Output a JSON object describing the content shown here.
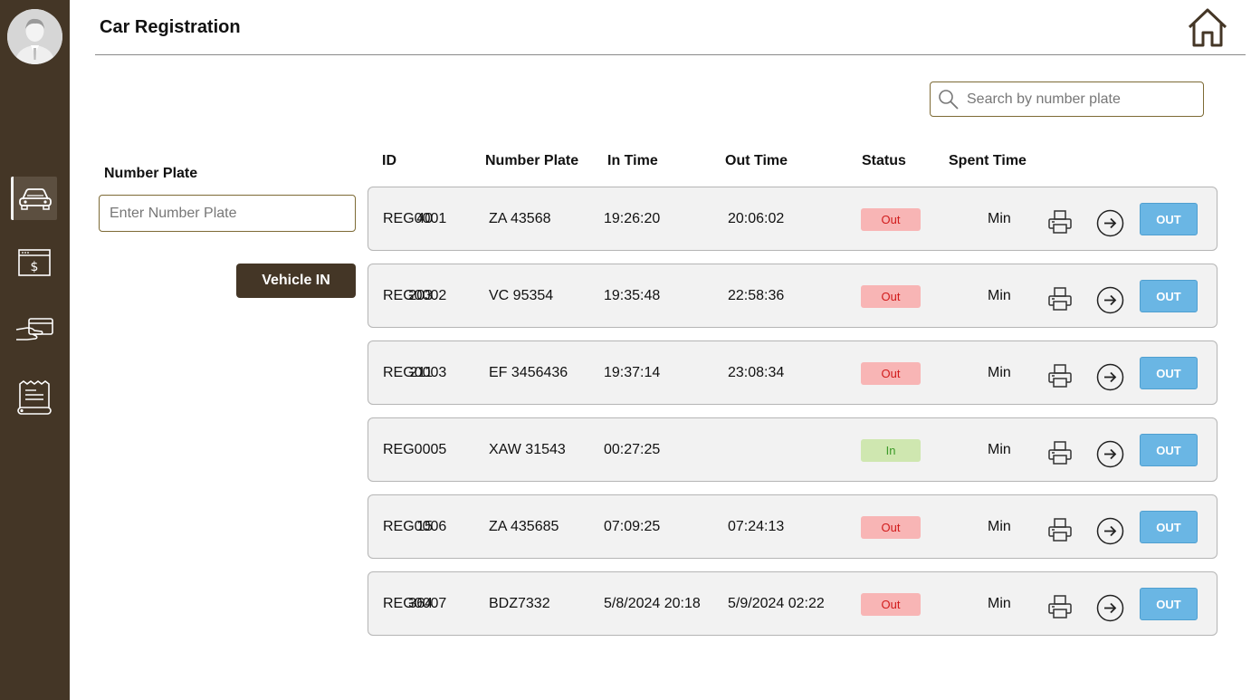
{
  "header": {
    "title": "Car Registration"
  },
  "search": {
    "placeholder": "Search by number plate"
  },
  "form": {
    "plate_label": "Number Plate",
    "plate_placeholder": "Enter Number Plate",
    "vehicle_in_label": "Vehicle IN"
  },
  "sidebar": {
    "items": [
      {
        "icon": "car-icon",
        "active": true
      },
      {
        "icon": "dollar-bill-icon",
        "active": false
      },
      {
        "icon": "card-payment-icon",
        "active": false
      },
      {
        "icon": "receipt-icon",
        "active": false
      }
    ]
  },
  "table": {
    "headers": [
      "ID",
      "Number Plate",
      "In Time",
      "Out Time",
      "Status",
      "Spent Time"
    ],
    "min_label": "Min",
    "out_button_label": "OUT",
    "rows": [
      {
        "id": "REG0001",
        "plate": "ZA 43568",
        "in_time": "19:26:20",
        "out_time": "20:06:02",
        "status": "Out",
        "spent": "40"
      },
      {
        "id": "REG0002",
        "plate": "VC 95354",
        "in_time": "19:35:48",
        "out_time": "22:58:36",
        "status": "Out",
        "spent": "203"
      },
      {
        "id": "REG0003",
        "plate": "EF 3456436",
        "in_time": "19:37:14",
        "out_time": "23:08:34",
        "status": "Out",
        "spent": "211"
      },
      {
        "id": "REG0005",
        "plate": "XAW 31543",
        "in_time": "00:27:25",
        "out_time": "",
        "status": "In",
        "spent": ""
      },
      {
        "id": "REG0006",
        "plate": "ZA 435685",
        "in_time": "07:09:25",
        "out_time": "07:24:13",
        "status": "Out",
        "spent": "15"
      },
      {
        "id": "REG0007",
        "plate": "BDZ7332",
        "in_time": "5/8/2024 20:18",
        "out_time": "5/9/2024 02:22",
        "status": "Out",
        "spent": "364"
      }
    ]
  },
  "colors": {
    "sidebar": "#443626",
    "accent_border": "#7d6a35",
    "out_button": "#6ab6e4",
    "status_out": "#f8b5b5",
    "status_in": "#cfe7b0"
  }
}
